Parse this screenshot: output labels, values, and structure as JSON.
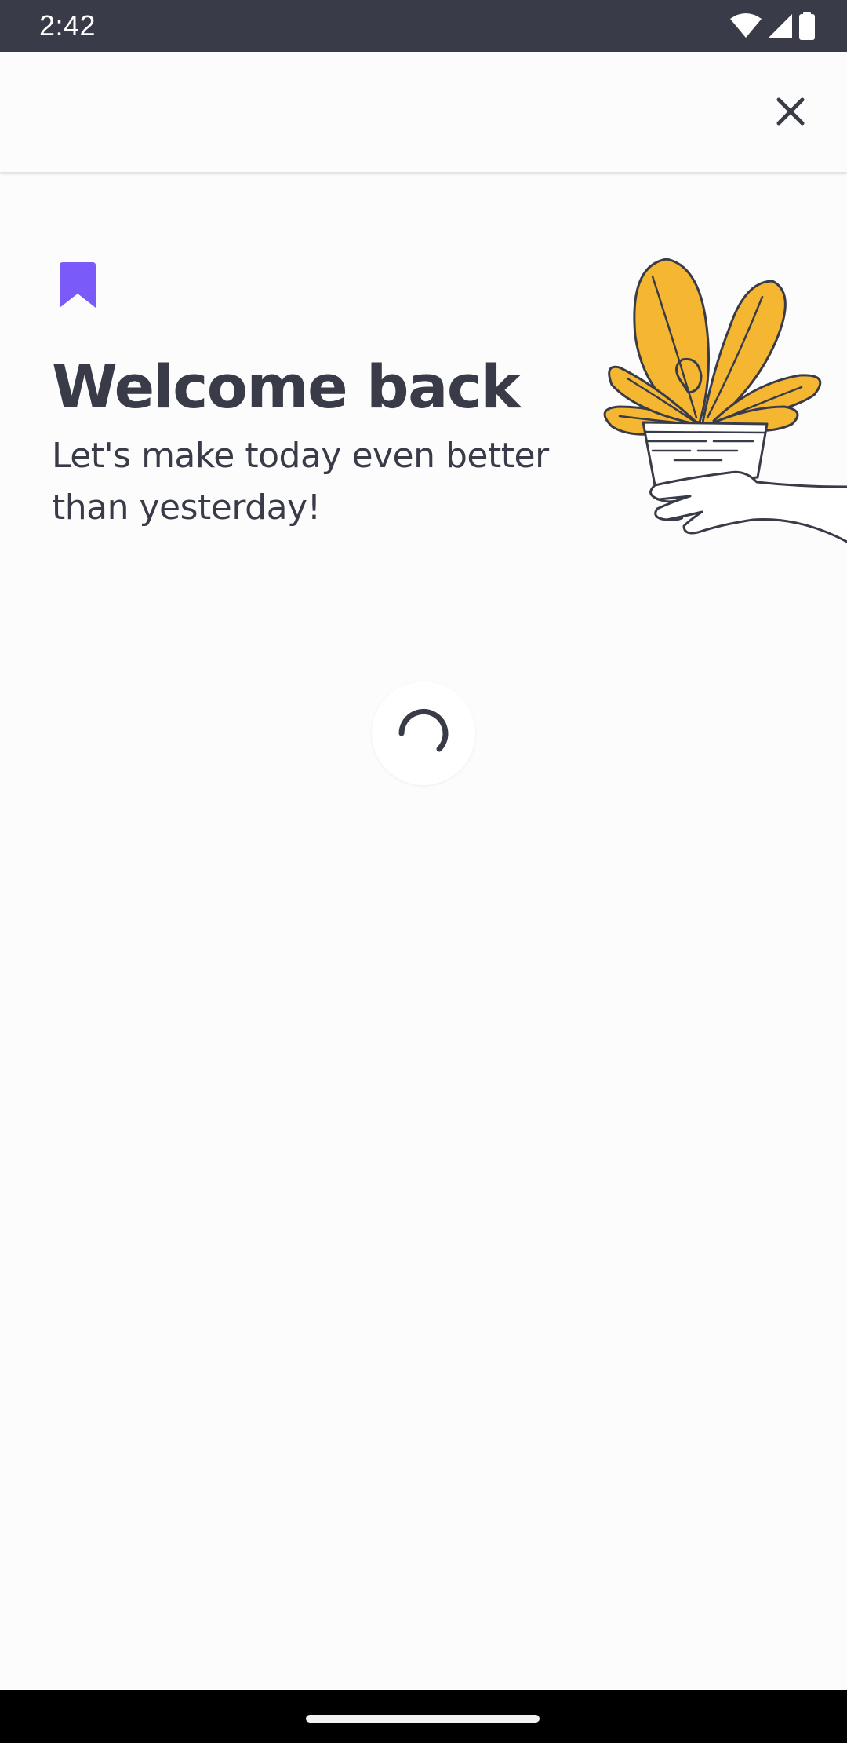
{
  "status_bar": {
    "time": "2:42",
    "icons": [
      "wifi-icon",
      "cellular-signal-icon",
      "battery-icon"
    ]
  },
  "top_bar": {
    "close_icon": "close-icon"
  },
  "welcome": {
    "bookmark_icon": "bookmark-icon",
    "title": "Welcome back",
    "subtitle": "Let's make today even better than yesterday!",
    "illustration": "potted-plant-in-hand-illustration"
  },
  "loading": {
    "indicator": "loading-spinner"
  },
  "colors": {
    "accent": "#7a5af8",
    "text_primary": "#393c48",
    "plant_yellow": "#f5b731",
    "status_bar": "#393c48",
    "background": "#fcfcfc"
  }
}
